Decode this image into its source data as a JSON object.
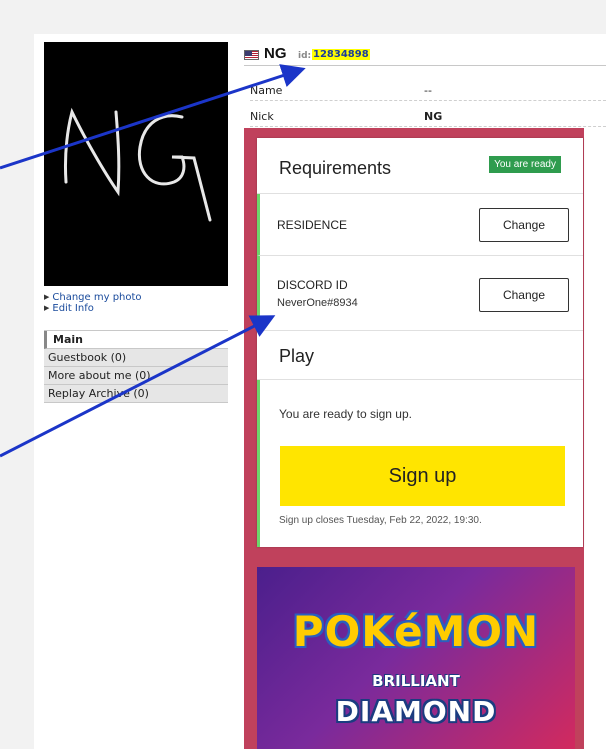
{
  "profile": {
    "nick": "NG",
    "id_label": "id:",
    "id_value": "12834898",
    "photo_text": "NG",
    "rows": [
      {
        "key": "Name",
        "value": "--"
      },
      {
        "key": "Nick",
        "value": "NG"
      }
    ]
  },
  "sidebar": {
    "links": [
      "Change my photo",
      "Edit Info"
    ],
    "nav": [
      "Main",
      "Guestbook (0)",
      "More about me (0)",
      "Replay Archive (0)"
    ]
  },
  "requirements": {
    "title": "Requirements",
    "badge": "You are ready",
    "items": [
      {
        "label": "RESIDENCE",
        "sub": "",
        "button": "Change"
      },
      {
        "label": "DISCORD ID",
        "sub": "NeverOne#8934",
        "button": "Change"
      }
    ]
  },
  "play": {
    "title": "Play",
    "ready_text": "You are ready to sign up.",
    "signup_label": "Sign up",
    "closes_text": "Sign up closes Tuesday, Feb 22, 2022, 19:30."
  },
  "game_art": {
    "line1": "POKéMON",
    "line2": "BRILLIANT",
    "line3": "DIAMOND"
  },
  "colors": {
    "accent_panel": "#c0415c",
    "badge_green": "#2f9c4e",
    "row_marker": "#6cd56b",
    "signup_yellow": "#ffe500",
    "arrow_blue": "#1b35c8",
    "id_highlight": "#ffff00"
  }
}
